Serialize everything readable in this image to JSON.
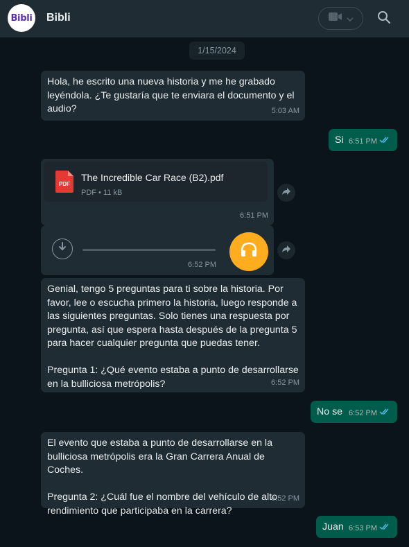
{
  "header": {
    "avatar_text": "Bibli",
    "contact_name": "Bibli",
    "video_icon": "video-camera-icon",
    "chevron_icon": "chevron-down-icon",
    "search_icon": "search-icon"
  },
  "colors": {
    "header_bg": "#202c33",
    "incoming_bubble": "#202c33",
    "outgoing_bubble": "#005c4b",
    "audio_accent": "#ffad1f",
    "pdf_red": "#e53935",
    "read_ticks": "#53bdeb"
  },
  "chat": {
    "date": "1/15/2024",
    "messages": [
      {
        "text": "Hola, he escrito una nueva historia y me he grabado\nleyéndola. ¿Te gustaría que te enviara el documento y el\naudio?",
        "time": "5:03 AM"
      },
      {
        "text": "Si",
        "time": "6:51 PM"
      },
      {
        "file_name": "The Incredible Car Race (B2).pdf",
        "file_type": "PDF",
        "file_size": "11 kB",
        "time": "6:51 PM"
      },
      {
        "time": "6:52 PM"
      },
      {
        "text": "Genial, tengo 5 preguntas para ti sobre la historia. Por\nfavor, lee o escucha primero la historia, luego responde a\nlas siguientes preguntas. Solo tienes una respuesta por\npregunta, así que espera hasta después de la pregunta 5\npara hacer cualquier pregunta que puedas tener.\n\nPregunta 1: ¿Qué evento estaba a punto de desarrollarse\nen la bulliciosa metrópolis?",
        "time": "6:52 PM"
      },
      {
        "text": "No se",
        "time": "6:52 PM"
      },
      {
        "text": "El evento que estaba a punto de desarrollarse en la\nbulliciosa metrópolis era la Gran Carrera Anual de Coches.\n\nPregunta 2: ¿Cuál fue el nombre del vehículo de alto\nrendimiento que participaba en la carrera?",
        "time": "6:52 PM"
      },
      {
        "text": "Juan",
        "time": "6:53 PM"
      }
    ]
  }
}
